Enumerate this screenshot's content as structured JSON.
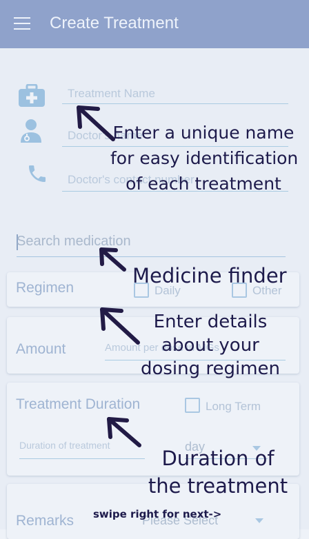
{
  "app": {
    "title": "Create Treatment"
  },
  "treatment_form": {
    "name_placeholder": "Treatment Name",
    "doctor_placeholder": "Doctor's name",
    "contact_placeholder": "Doctor's contact number"
  },
  "search": {
    "placeholder": "Search medication"
  },
  "regimen": {
    "label": "Regimen",
    "options": [
      "Daily",
      "Other"
    ]
  },
  "amount": {
    "label": "Amount",
    "field_placeholder": "Amount per dose in MGs"
  },
  "duration": {
    "label": "Treatment Duration",
    "long_term_label": "Long Term",
    "field_placeholder": "Duration of treatment",
    "unit_value": "day"
  },
  "remarks": {
    "label": "Remarks",
    "select_value": "Please Select"
  },
  "overlay": {
    "name_tip": [
      "Enter a unique name",
      "for easy identification",
      "of each treatment"
    ],
    "finder_tip": "Medicine finder",
    "regimen_tip": [
      "Enter details",
      "about your",
      "dosing regimen"
    ],
    "duration_tip": [
      "Duration of",
      "the treatment"
    ],
    "swipe_hint": "swipe right for next->"
  }
}
